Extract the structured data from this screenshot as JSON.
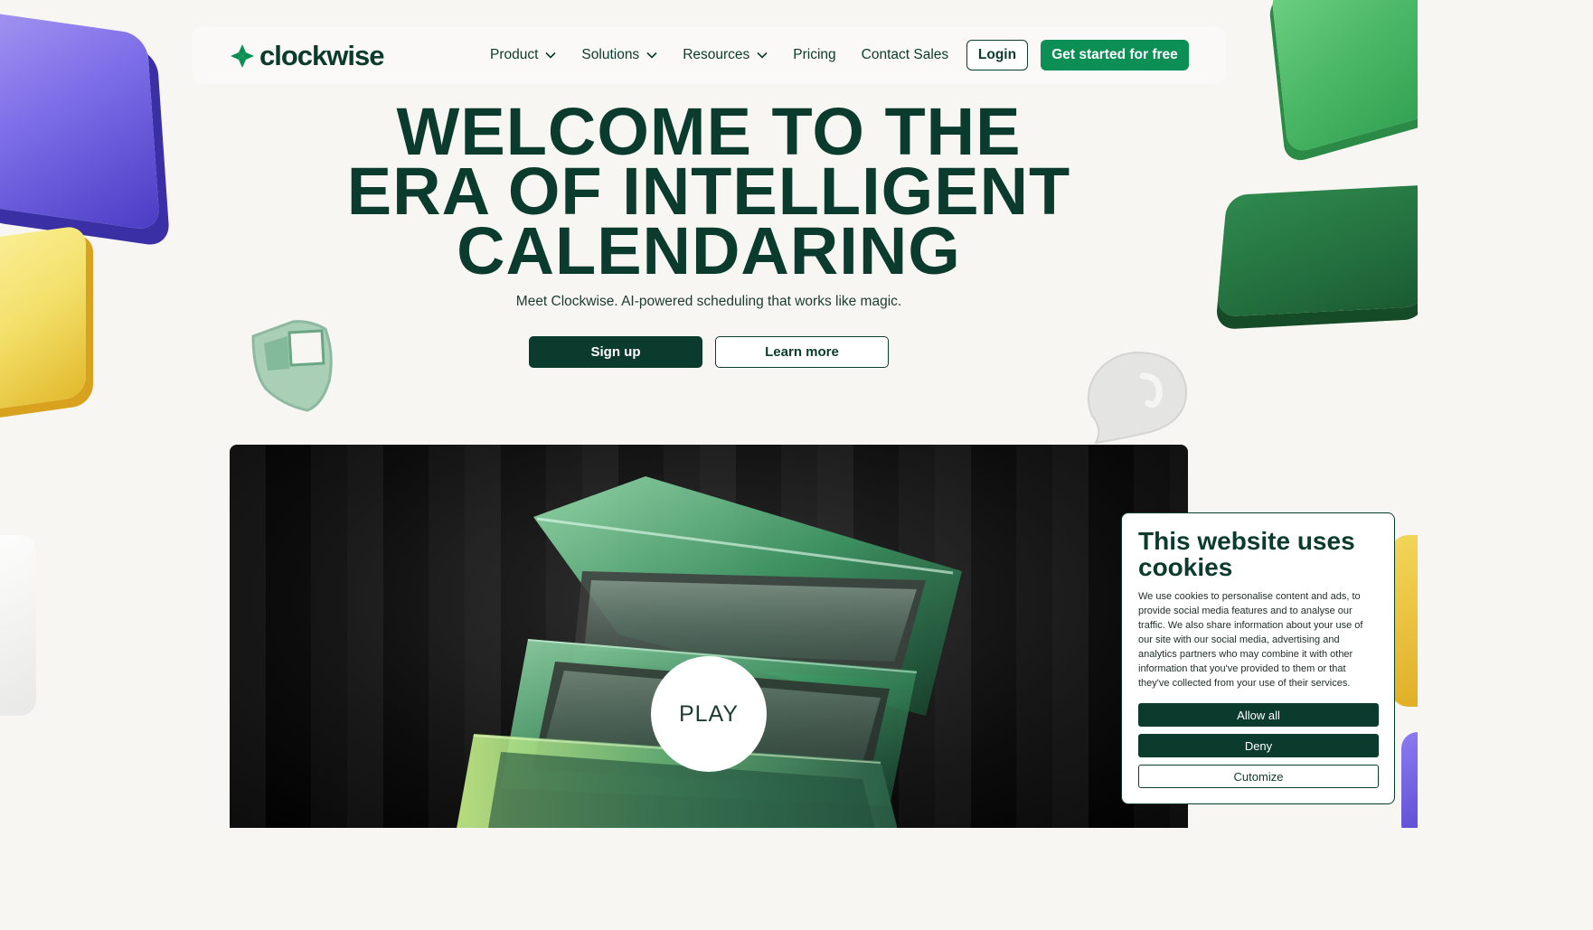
{
  "brand": {
    "name": "clockwise",
    "color": "#0b8f54",
    "dark": "#0b3b2c"
  },
  "nav": {
    "items": [
      {
        "label": "Product",
        "has_dropdown": true
      },
      {
        "label": "Solutions",
        "has_dropdown": true
      },
      {
        "label": "Resources",
        "has_dropdown": true
      },
      {
        "label": "Pricing",
        "has_dropdown": false
      },
      {
        "label": "Contact Sales",
        "has_dropdown": false
      }
    ],
    "login_label": "Login",
    "cta_label": "Get started for free"
  },
  "hero": {
    "title_line1": "WELCOME TO THE",
    "title_line2": "ERA OF INTELLIGENT",
    "title_line3": "CALENDARING",
    "subtitle": "Meet Clockwise. AI-powered scheduling that works like magic.",
    "signup_label": "Sign up",
    "learn_label": "Learn more"
  },
  "video": {
    "play_label": "PLAY"
  },
  "cookie": {
    "title": "This website uses cookies",
    "body": "We use cookies to personalise content and ads, to provide social media features and to analyse our traffic. We also share information about your use of our site with our social media, advertising and analytics partners who may combine it with other information that you've provided to them or that they've collected from your use of their services.",
    "allow_label": "Allow all",
    "deny_label": "Deny",
    "customize_label": "Cutomize"
  }
}
